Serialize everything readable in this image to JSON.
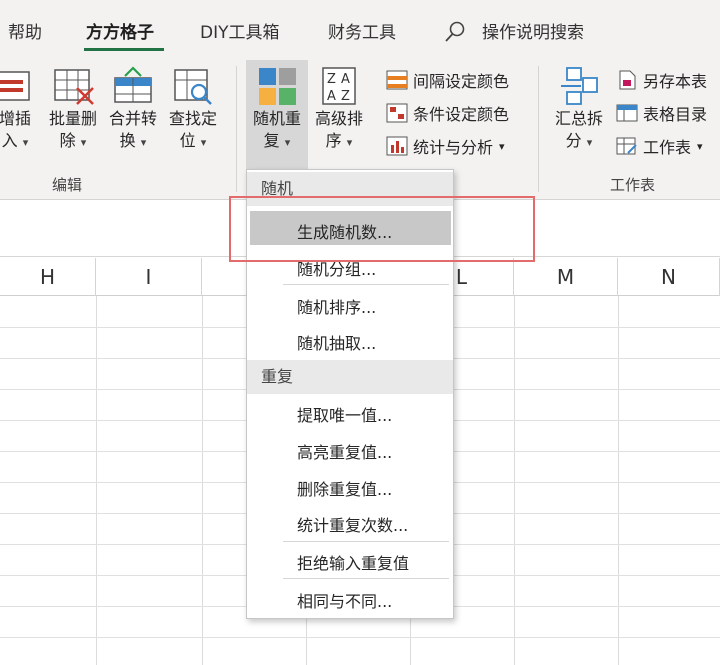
{
  "tabs": [
    {
      "label": "帮助",
      "active": false
    },
    {
      "label": "方方格子",
      "active": true
    },
    {
      "label": "DIY工具箱",
      "active": false
    },
    {
      "label": "财务工具",
      "active": false
    }
  ],
  "search": {
    "label": "操作说明搜索"
  },
  "ribbon": {
    "insert": {
      "line1": "增插",
      "line2": "入"
    },
    "batch_delete": {
      "line1": "批量删",
      "line2": "除"
    },
    "merge_convert": {
      "line1": "合并转",
      "line2": "换"
    },
    "find_locate": {
      "line1": "查找定",
      "line2": "位"
    },
    "random_repeat": {
      "line1": "随机重",
      "line2": "复"
    },
    "advanced_sort": {
      "line1": "高级排",
      "line2": "序"
    },
    "interval_color": "间隔设定颜色",
    "condition_color": "条件设定颜色",
    "stats_analysis": "统计与分析",
    "summary_split": {
      "line1": "汇总拆",
      "line2": "分"
    },
    "save_copy": "另存本表",
    "table_index": "表格目录",
    "worksheet": "工作表",
    "group_edit": "编辑",
    "group_worksheet": "工作表"
  },
  "columns": [
    "H",
    "I",
    "L",
    "M",
    "N"
  ],
  "menu": {
    "header_random": "随机",
    "item_generate": "生成随机数...",
    "item_random_split": "随机分组...",
    "item_random_sort": "随机排序...",
    "item_random_pick": "随机抽取...",
    "header_repeat": "重复",
    "item_extract_unique": "提取唯一值...",
    "item_highlight_dup": "高亮重复值...",
    "item_delete_dup": "删除重复值...",
    "item_count_dup": "统计重复次数...",
    "item_reject_dup": "拒绝输入重复值",
    "item_same_diff": "相同与不同..."
  },
  "colors": {
    "accent_green": "#217346",
    "annotation_red": "#e26b6b",
    "ribbon_bg": "#f3f2f1"
  }
}
